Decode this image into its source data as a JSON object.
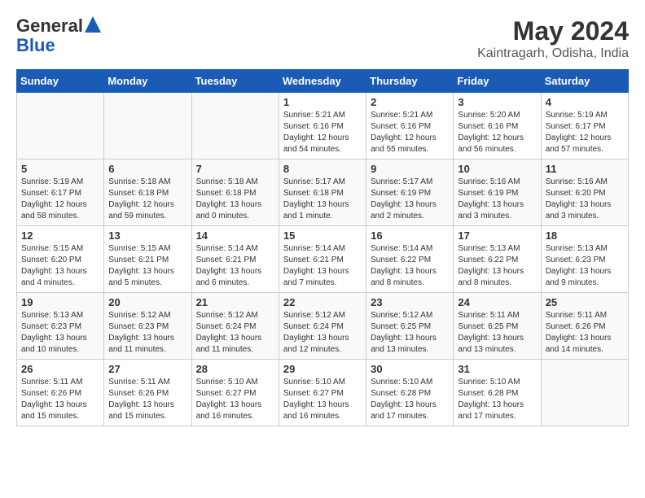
{
  "header": {
    "logo_line1": "General",
    "logo_line2": "Blue",
    "title": "May 2024",
    "subtitle": "Kaintragarh, Odisha, India"
  },
  "days_of_week": [
    "Sunday",
    "Monday",
    "Tuesday",
    "Wednesday",
    "Thursday",
    "Friday",
    "Saturday"
  ],
  "weeks": [
    [
      {
        "day": "",
        "sunrise": "",
        "sunset": "",
        "daylight": ""
      },
      {
        "day": "",
        "sunrise": "",
        "sunset": "",
        "daylight": ""
      },
      {
        "day": "",
        "sunrise": "",
        "sunset": "",
        "daylight": ""
      },
      {
        "day": "1",
        "sunrise": "Sunrise: 5:21 AM",
        "sunset": "Sunset: 6:16 PM",
        "daylight": "Daylight: 12 hours and 54 minutes."
      },
      {
        "day": "2",
        "sunrise": "Sunrise: 5:21 AM",
        "sunset": "Sunset: 6:16 PM",
        "daylight": "Daylight: 12 hours and 55 minutes."
      },
      {
        "day": "3",
        "sunrise": "Sunrise: 5:20 AM",
        "sunset": "Sunset: 6:16 PM",
        "daylight": "Daylight: 12 hours and 56 minutes."
      },
      {
        "day": "4",
        "sunrise": "Sunrise: 5:19 AM",
        "sunset": "Sunset: 6:17 PM",
        "daylight": "Daylight: 12 hours and 57 minutes."
      }
    ],
    [
      {
        "day": "5",
        "sunrise": "Sunrise: 5:19 AM",
        "sunset": "Sunset: 6:17 PM",
        "daylight": "Daylight: 12 hours and 58 minutes."
      },
      {
        "day": "6",
        "sunrise": "Sunrise: 5:18 AM",
        "sunset": "Sunset: 6:18 PM",
        "daylight": "Daylight: 12 hours and 59 minutes."
      },
      {
        "day": "7",
        "sunrise": "Sunrise: 5:18 AM",
        "sunset": "Sunset: 6:18 PM",
        "daylight": "Daylight: 13 hours and 0 minutes."
      },
      {
        "day": "8",
        "sunrise": "Sunrise: 5:17 AM",
        "sunset": "Sunset: 6:18 PM",
        "daylight": "Daylight: 13 hours and 1 minute."
      },
      {
        "day": "9",
        "sunrise": "Sunrise: 5:17 AM",
        "sunset": "Sunset: 6:19 PM",
        "daylight": "Daylight: 13 hours and 2 minutes."
      },
      {
        "day": "10",
        "sunrise": "Sunrise: 5:16 AM",
        "sunset": "Sunset: 6:19 PM",
        "daylight": "Daylight: 13 hours and 3 minutes."
      },
      {
        "day": "11",
        "sunrise": "Sunrise: 5:16 AM",
        "sunset": "Sunset: 6:20 PM",
        "daylight": "Daylight: 13 hours and 3 minutes."
      }
    ],
    [
      {
        "day": "12",
        "sunrise": "Sunrise: 5:15 AM",
        "sunset": "Sunset: 6:20 PM",
        "daylight": "Daylight: 13 hours and 4 minutes."
      },
      {
        "day": "13",
        "sunrise": "Sunrise: 5:15 AM",
        "sunset": "Sunset: 6:21 PM",
        "daylight": "Daylight: 13 hours and 5 minutes."
      },
      {
        "day": "14",
        "sunrise": "Sunrise: 5:14 AM",
        "sunset": "Sunset: 6:21 PM",
        "daylight": "Daylight: 13 hours and 6 minutes."
      },
      {
        "day": "15",
        "sunrise": "Sunrise: 5:14 AM",
        "sunset": "Sunset: 6:21 PM",
        "daylight": "Daylight: 13 hours and 7 minutes."
      },
      {
        "day": "16",
        "sunrise": "Sunrise: 5:14 AM",
        "sunset": "Sunset: 6:22 PM",
        "daylight": "Daylight: 13 hours and 8 minutes."
      },
      {
        "day": "17",
        "sunrise": "Sunrise: 5:13 AM",
        "sunset": "Sunset: 6:22 PM",
        "daylight": "Daylight: 13 hours and 8 minutes."
      },
      {
        "day": "18",
        "sunrise": "Sunrise: 5:13 AM",
        "sunset": "Sunset: 6:23 PM",
        "daylight": "Daylight: 13 hours and 9 minutes."
      }
    ],
    [
      {
        "day": "19",
        "sunrise": "Sunrise: 5:13 AM",
        "sunset": "Sunset: 6:23 PM",
        "daylight": "Daylight: 13 hours and 10 minutes."
      },
      {
        "day": "20",
        "sunrise": "Sunrise: 5:12 AM",
        "sunset": "Sunset: 6:23 PM",
        "daylight": "Daylight: 13 hours and 11 minutes."
      },
      {
        "day": "21",
        "sunrise": "Sunrise: 5:12 AM",
        "sunset": "Sunset: 6:24 PM",
        "daylight": "Daylight: 13 hours and 11 minutes."
      },
      {
        "day": "22",
        "sunrise": "Sunrise: 5:12 AM",
        "sunset": "Sunset: 6:24 PM",
        "daylight": "Daylight: 13 hours and 12 minutes."
      },
      {
        "day": "23",
        "sunrise": "Sunrise: 5:12 AM",
        "sunset": "Sunset: 6:25 PM",
        "daylight": "Daylight: 13 hours and 13 minutes."
      },
      {
        "day": "24",
        "sunrise": "Sunrise: 5:11 AM",
        "sunset": "Sunset: 6:25 PM",
        "daylight": "Daylight: 13 hours and 13 minutes."
      },
      {
        "day": "25",
        "sunrise": "Sunrise: 5:11 AM",
        "sunset": "Sunset: 6:26 PM",
        "daylight": "Daylight: 13 hours and 14 minutes."
      }
    ],
    [
      {
        "day": "26",
        "sunrise": "Sunrise: 5:11 AM",
        "sunset": "Sunset: 6:26 PM",
        "daylight": "Daylight: 13 hours and 15 minutes."
      },
      {
        "day": "27",
        "sunrise": "Sunrise: 5:11 AM",
        "sunset": "Sunset: 6:26 PM",
        "daylight": "Daylight: 13 hours and 15 minutes."
      },
      {
        "day": "28",
        "sunrise": "Sunrise: 5:10 AM",
        "sunset": "Sunset: 6:27 PM",
        "daylight": "Daylight: 13 hours and 16 minutes."
      },
      {
        "day": "29",
        "sunrise": "Sunrise: 5:10 AM",
        "sunset": "Sunset: 6:27 PM",
        "daylight": "Daylight: 13 hours and 16 minutes."
      },
      {
        "day": "30",
        "sunrise": "Sunrise: 5:10 AM",
        "sunset": "Sunset: 6:28 PM",
        "daylight": "Daylight: 13 hours and 17 minutes."
      },
      {
        "day": "31",
        "sunrise": "Sunrise: 5:10 AM",
        "sunset": "Sunset: 6:28 PM",
        "daylight": "Daylight: 13 hours and 17 minutes."
      },
      {
        "day": "",
        "sunrise": "",
        "sunset": "",
        "daylight": ""
      }
    ]
  ]
}
